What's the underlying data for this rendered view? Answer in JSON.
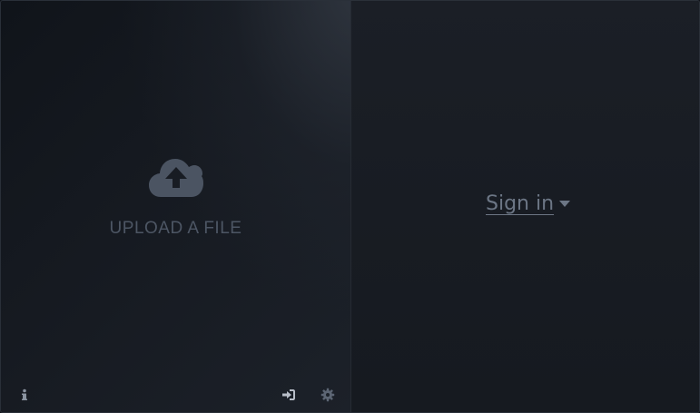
{
  "upload": {
    "label": "UPLOAD A FILE",
    "icon": "cloud-upload-icon"
  },
  "auth": {
    "signin_label": "Sign in",
    "caret_icon": "caret-down-icon"
  },
  "footer": {
    "icons": [
      "info-icon",
      "sign-in-icon",
      "gear-icon"
    ]
  },
  "colors": {
    "background": "#171b22",
    "muted_text": "#4d5664",
    "link_text": "#6c7685",
    "icon": "#5c6573"
  }
}
